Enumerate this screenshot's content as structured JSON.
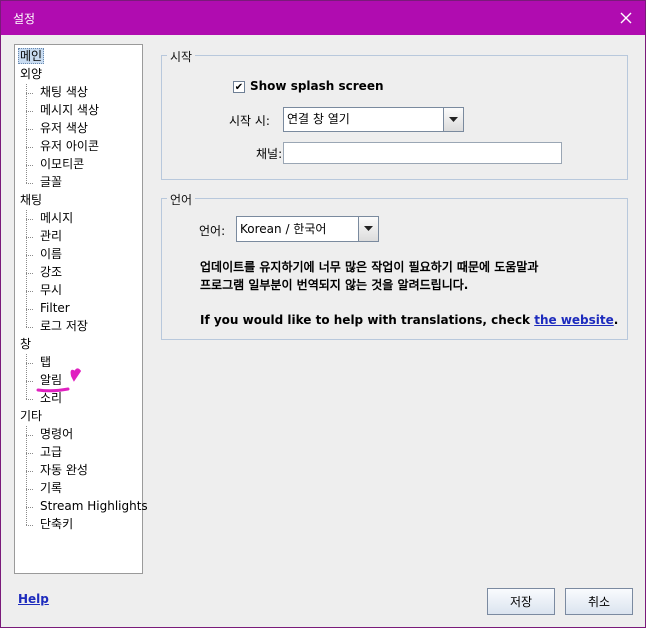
{
  "window": {
    "title": "설정"
  },
  "tree": {
    "groups": [
      {
        "label": "메인",
        "selected": true,
        "children": []
      },
      {
        "label": "외양",
        "children": [
          "채팅 색상",
          "메시지 색상",
          "유저 색상",
          "유저 아이콘",
          "이모티콘",
          "글꼴"
        ]
      },
      {
        "label": "채팅",
        "children": [
          "메시지",
          "관리",
          "이름",
          "강조",
          "무시",
          "Filter",
          "로그 저장"
        ]
      },
      {
        "label": "창",
        "children": [
          "탭",
          "알림",
          "소리"
        ]
      },
      {
        "label": "기타",
        "children": [
          "명령어",
          "고급",
          "자동 완성",
          "기록",
          "Stream Highlights",
          "단축키"
        ]
      }
    ],
    "annotation_color": "#e020c0"
  },
  "start_section": {
    "title": "시작",
    "splash_label": "Show splash screen",
    "splash_checked": true,
    "on_start_label": "시작 시:",
    "on_start_value": "연결 창 열기",
    "channel_label": "채널:",
    "channel_value": ""
  },
  "language_section": {
    "title": "언어",
    "language_label": "언어:",
    "language_value": "Korean / 한국어",
    "note_line1": "업데이트를 유지하기에 너무 많은 작업이 필요하기 때문에 도움말과",
    "note_line2": "프로그램 일부분이 번역되지 않는 것을 알려드립니다.",
    "help_prefix": "If you would like to help with translations, check ",
    "help_link": "the website",
    "help_suffix": "."
  },
  "footer": {
    "help_link": "Help",
    "save_label": "저장",
    "cancel_label": "취소"
  },
  "colors": {
    "titlebar": "#b00cb0",
    "link": "#1d2bbd",
    "selection": "#c9dcf1"
  }
}
